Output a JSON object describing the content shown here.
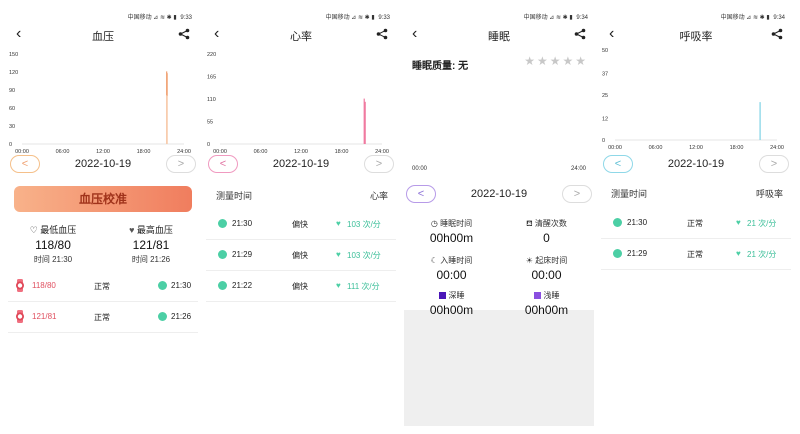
{
  "status": {
    "carrier": "中国移动",
    "icons": "⊿ ≋ ✱ ▮",
    "time1": "9:33",
    "time2": "9:34"
  },
  "panel1": {
    "title": "血压",
    "date": "2022-10-19",
    "prev": "<",
    "next": ">",
    "calibrate": "血压校准",
    "min_label": "最低血压",
    "min_value": "118/80",
    "min_time": "时间 21:30",
    "max_label": "最高血压",
    "max_value": "121/81",
    "max_time": "时间 21:26",
    "records": [
      {
        "value": "118/80",
        "status": "正常",
        "time": "21:30"
      },
      {
        "value": "121/81",
        "status": "正常",
        "time": "21:26"
      }
    ]
  },
  "panel2": {
    "title": "心率",
    "date": "2022-10-19",
    "prev": "<",
    "next": ">",
    "col_time": "测量时间",
    "col_rate": "心率",
    "records": [
      {
        "time": "21:30",
        "status": "偏快",
        "rate": "103 次/分"
      },
      {
        "time": "21:29",
        "status": "偏快",
        "rate": "103 次/分"
      },
      {
        "time": "21:22",
        "status": "偏快",
        "rate": "111 次/分"
      }
    ]
  },
  "panel3": {
    "title": "睡眠",
    "quality_label": "睡眠质量: 无",
    "stars": "★★★★★",
    "date": "2022-10-19",
    "prev": "<",
    "next": ">",
    "x_start": "00:00",
    "x_end": "24:00",
    "sleep_time_label": "睡眠时间",
    "sleep_time_value": "00h00m",
    "wake_count_label": "清醒次数",
    "wake_count_value": "0",
    "bed_label": "入睡时间",
    "bed_value": "00:00",
    "rise_label": "起床时间",
    "rise_value": "00:00",
    "deep_label": "深睡",
    "deep_value": "00h00m",
    "light_label": "浅睡",
    "light_value": "00h00m"
  },
  "panel4": {
    "title": "呼吸率",
    "date": "2022-10-19",
    "prev": "<",
    "next": ">",
    "col_time": "测量时间",
    "col_rate": "呼吸率",
    "records": [
      {
        "time": "21:30",
        "status": "正常",
        "rate": "21 次/分"
      },
      {
        "time": "21:29",
        "status": "正常",
        "rate": "21 次/分"
      }
    ]
  },
  "chart_data": [
    {
      "type": "bar",
      "title": "",
      "yticks": [
        "150",
        "120",
        "90",
        "60",
        "30",
        "0"
      ],
      "ylim": [
        0,
        150
      ],
      "xticks": [
        "00:00",
        "06:00",
        "12:00",
        "18:00",
        "24:00"
      ],
      "series": [
        {
          "x": "21:30",
          "low": 80,
          "high": 118
        },
        {
          "x": "21:26",
          "low": 81,
          "high": 121
        }
      ],
      "color": "#f0a070"
    },
    {
      "type": "bar",
      "title": "",
      "yticks": [
        "220",
        "165",
        "110",
        "55",
        "0"
      ],
      "ylim": [
        0,
        220
      ],
      "xticks": [
        "00:00",
        "06:00",
        "12:00",
        "18:00",
        "24:00"
      ],
      "series": [
        {
          "x": "21:30",
          "value": 103
        },
        {
          "x": "21:29",
          "value": 103
        },
        {
          "x": "21:22",
          "value": 111
        }
      ],
      "color": "#f07aa0"
    },
    {
      "type": "bar",
      "title": "",
      "yticks": [
        "50",
        "37",
        "25",
        "12",
        "0"
      ],
      "ylim": [
        0,
        50
      ],
      "xticks": [
        "00:00",
        "06:00",
        "12:00",
        "18:00",
        "24:00"
      ],
      "series": [
        {
          "x": "21:30",
          "value": 21
        },
        {
          "x": "21:29",
          "value": 21
        }
      ],
      "color": "#8fd8e8"
    }
  ]
}
